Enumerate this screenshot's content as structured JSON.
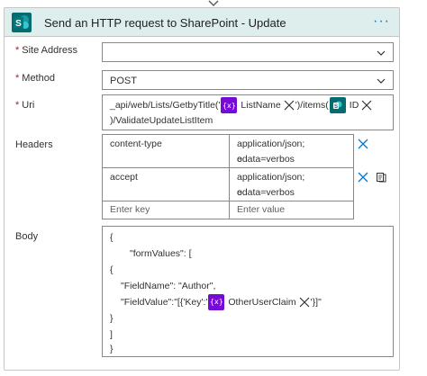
{
  "card": {
    "title": "Send an HTTP request to SharePoint - Update",
    "more_label": "···"
  },
  "site_address": {
    "label": "Site Address",
    "required_mark": "*",
    "value": ""
  },
  "method": {
    "label": "Method",
    "required_mark": "*",
    "value": "POST"
  },
  "uri": {
    "label": "Uri",
    "required_mark": "*",
    "line1_prefix": "_api/web/Lists/GetbyTitle('",
    "token1_icon": "{x}",
    "token1_label": "ListName",
    "line1_middle": "')/items(",
    "token2_label": "ID",
    "line2": ")/ValidateUpdateListItem"
  },
  "headers": {
    "label": "Headers",
    "rows": [
      {
        "key": "content-type",
        "value_line1": "application/json; odata=verbos",
        "value_line2": "e"
      },
      {
        "key": "accept",
        "value_line1": "application/json; odata=verbos",
        "value_line2": "e"
      }
    ],
    "key_placeholder": "Enter key",
    "value_placeholder": "Enter value"
  },
  "body": {
    "label": "Body",
    "lines": [
      "{",
      "\"formValues\": [",
      "{",
      "\"FieldName\": \"Author\",",
      "}",
      "]",
      "}"
    ],
    "field_value_prefix": "\"FieldValue\":\"[{'Key':'",
    "token_icon": "{x}",
    "token_label": "OtherUserClaim",
    "field_value_suffix": "'}]\""
  },
  "colors": {
    "header_bg": "#ddeeed",
    "variable_token": "#770bd6",
    "sharepoint_token": "#036c70",
    "required": "#a4262c",
    "accent": "#0078d4"
  }
}
